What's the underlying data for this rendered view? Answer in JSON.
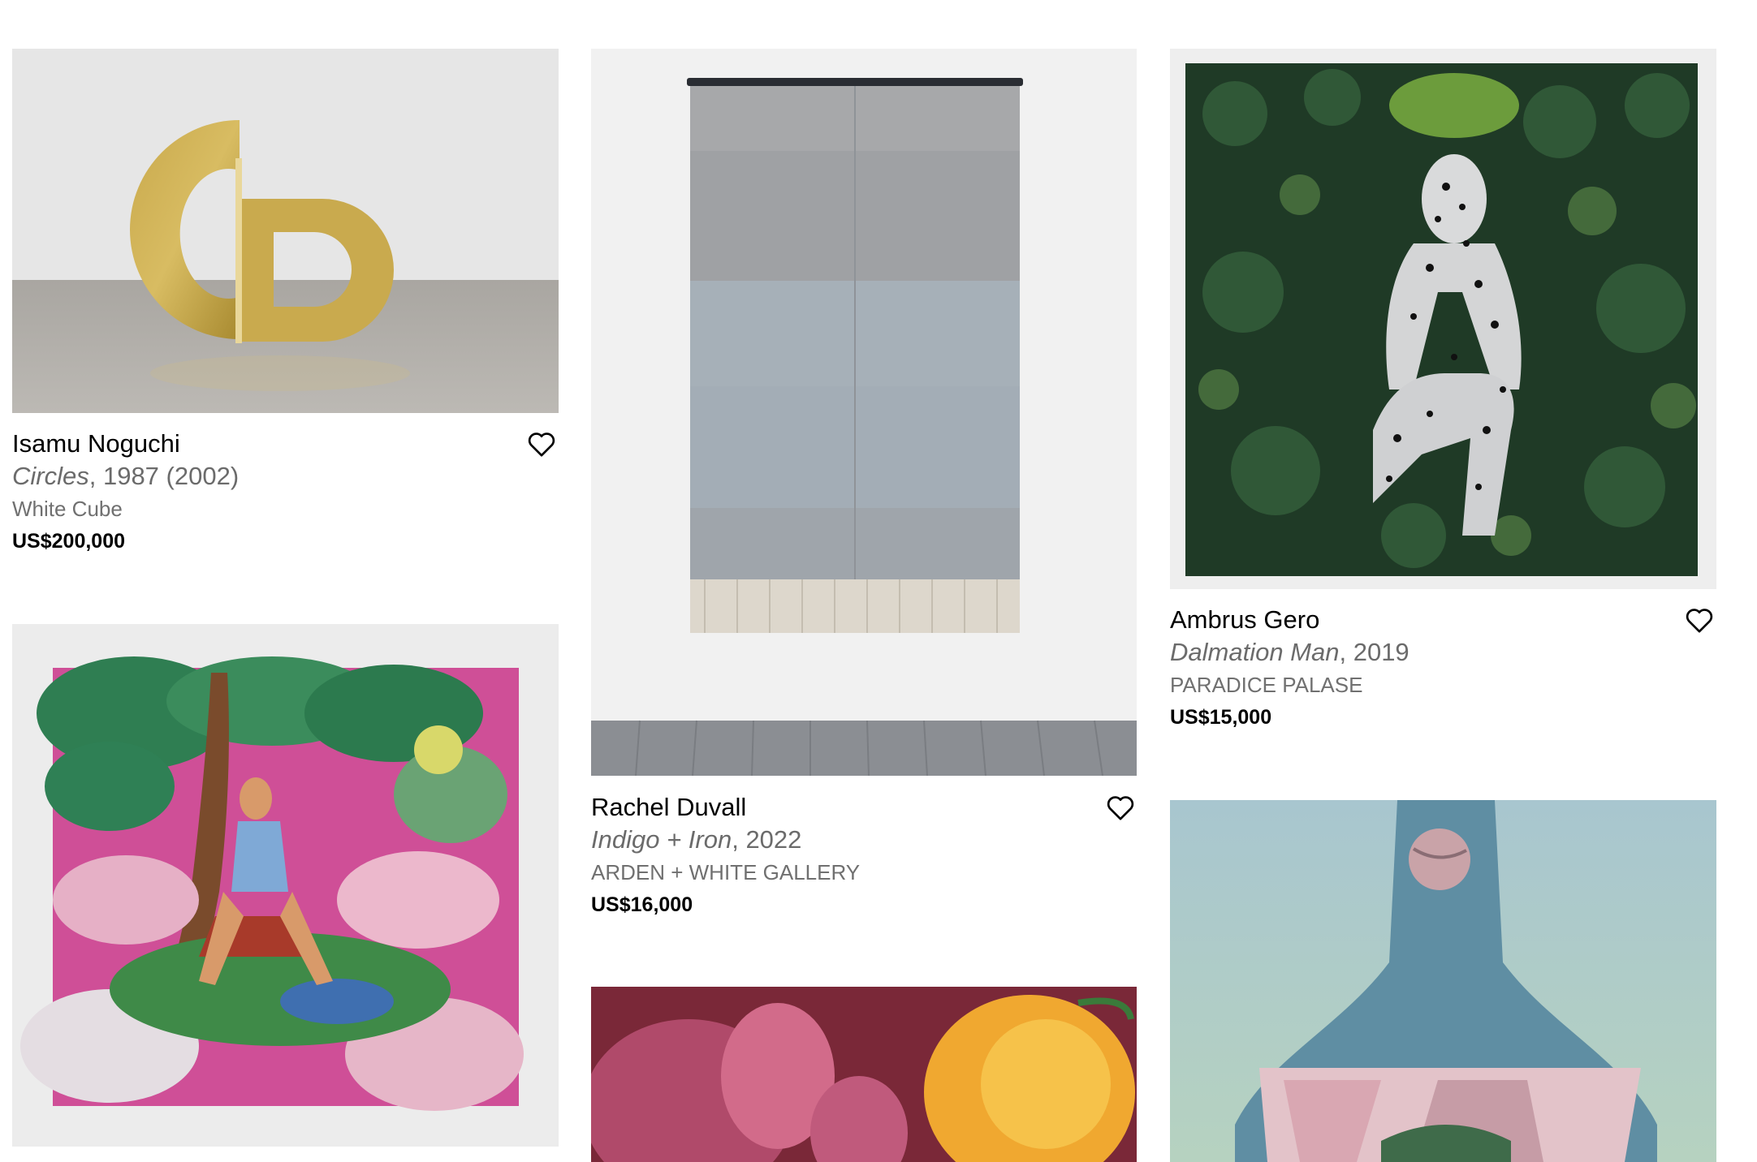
{
  "artworks": [
    {
      "artist": "Isamu Noguchi",
      "title": "Circles",
      "date": ", 1987 (2002)",
      "gallery": "White Cube",
      "price": "US$200,000"
    },
    {
      "artist": "Rachel Duvall",
      "title": "Indigo + Iron",
      "date": ", 2022",
      "gallery": "ARDEN + WHITE GALLERY",
      "price": "US$16,000"
    },
    {
      "artist": "Ambrus Gero",
      "title": "Dalmation Man",
      "date": ", 2019",
      "gallery": "PARADICE PALASE",
      "price": "US$15,000"
    }
  ],
  "icons": {
    "save": "heart-outline-icon"
  }
}
